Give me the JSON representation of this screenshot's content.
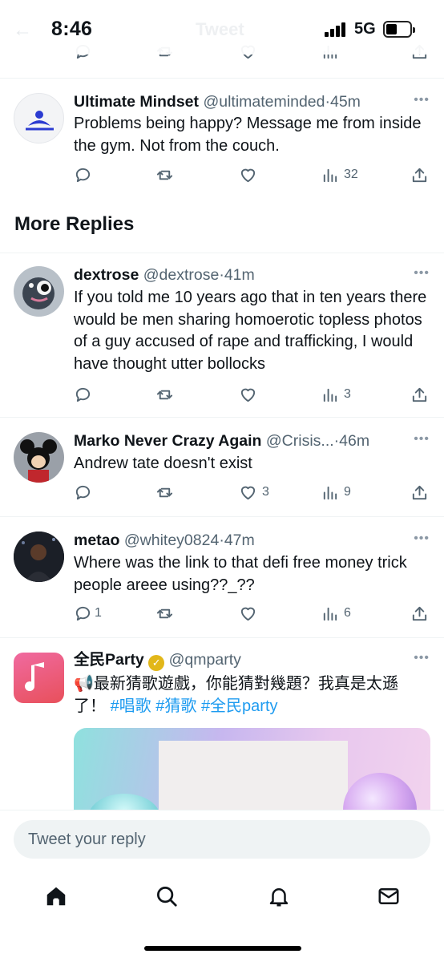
{
  "status_bar": {
    "time": "8:46",
    "network": "5G",
    "faded_title": "Tweet"
  },
  "top_tweet": {
    "name": "Ultimate Mindset",
    "handle": "@ultimateminded",
    "time": "45m",
    "text": "Problems being happy? Message me from inside the gym. Not from the couch.",
    "views": "32"
  },
  "section": {
    "title": "More Replies"
  },
  "replies": [
    {
      "name": "dextrose",
      "handle": "@dextrose",
      "time": "41m",
      "text": "If you told me 10 years ago that in ten years there would be men sharing homoerotic topless photos of a guy accused of rape and trafficking, I would have thought utter bollocks",
      "views": "3"
    },
    {
      "name": "Marko Never Crazy Again",
      "handle": "@Crisis...",
      "time": "46m",
      "text": "Andrew tate doesn't exist",
      "likes": "3",
      "views": "9"
    },
    {
      "name": "metao",
      "handle": "@whitey0824",
      "time": "47m",
      "text": "Where was the link to that defi free money trick people areee using??_??",
      "replies": "1",
      "views": "6"
    }
  ],
  "promoted": {
    "name": "全民Party",
    "handle": "@qmparty",
    "text": "最新猜歌遊戲，你能猜對幾題？我真是太遜了！",
    "hashtags": [
      "#唱歌",
      "#猜歌",
      "#全民party"
    ]
  },
  "reply_bar": {
    "placeholder": "Tweet your reply"
  },
  "colors": {
    "accent": "#1d9bf0",
    "secondary_text": "#536471",
    "divider": "#eff3f4",
    "verified_gold": "#e2b719"
  },
  "tabs": [
    "home-icon",
    "search-icon",
    "notifications-icon",
    "messages-icon"
  ]
}
